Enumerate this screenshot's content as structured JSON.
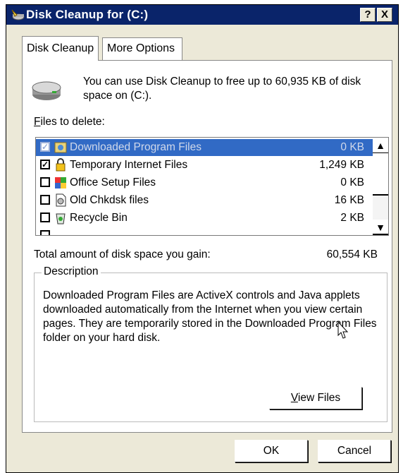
{
  "window": {
    "title": "Disk Cleanup for  (C:)",
    "help_label": "?",
    "close_label": "X"
  },
  "tabs": [
    {
      "label": "Disk Cleanup",
      "active": true
    },
    {
      "label": "More Options",
      "active": false
    }
  ],
  "intro_text": "You can use Disk Cleanup to free up to 60,935 KB of disk space on  (C:).",
  "files_label": {
    "accel": "F",
    "rest": "iles to delete:"
  },
  "files": [
    {
      "name": "Downloaded Program Files",
      "size": "0 KB",
      "checked": true,
      "selected": true,
      "icon": "downloaded-program-files-icon"
    },
    {
      "name": "Temporary Internet Files",
      "size": "1,249 KB",
      "checked": true,
      "selected": false,
      "icon": "lock-icon"
    },
    {
      "name": "Office Setup Files",
      "size": "0 KB",
      "checked": false,
      "selected": false,
      "icon": "office-icon"
    },
    {
      "name": "Old Chkdsk files",
      "size": "16 KB",
      "checked": false,
      "selected": false,
      "icon": "document-icon"
    },
    {
      "name": "Recycle Bin",
      "size": "2 KB",
      "checked": false,
      "selected": false,
      "icon": "recycle-bin-icon"
    }
  ],
  "total": {
    "label": "Total amount of disk space you gain:",
    "value": "60,554 KB"
  },
  "description": {
    "legend": "Description",
    "text": "Downloaded Program Files are ActiveX controls and Java applets downloaded automatically from the Internet when you view certain pages. They are temporarily stored in the Downloaded Program Files folder on your hard disk."
  },
  "buttons": {
    "view_files": {
      "accel": "V",
      "rest": "iew Files"
    },
    "ok": "OK",
    "cancel": "Cancel"
  },
  "colors": {
    "titlebar": "#0a246a",
    "selection": "#316ac5",
    "dialog_bg": "#ece9d8"
  }
}
